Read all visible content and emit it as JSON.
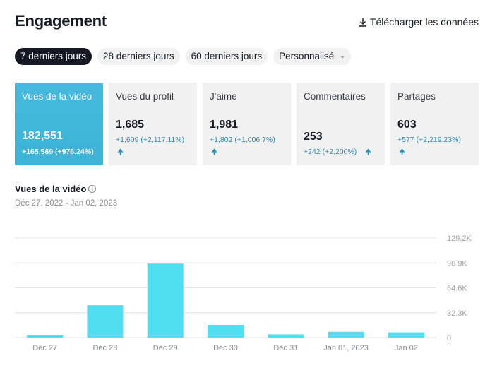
{
  "header": {
    "title": "Engagement",
    "download_label": "Télécharger les données"
  },
  "tabs": [
    {
      "label": "7 derniers jours",
      "active": true
    },
    {
      "label": "28 derniers jours",
      "active": false
    },
    {
      "label": "60 derniers jours",
      "active": false
    },
    {
      "label": "Personnalisé",
      "active": false
    }
  ],
  "cards": [
    {
      "label": "Vues de la vidéo",
      "value": "182,551",
      "delta": "+165,589 (+976.24%)",
      "active": true
    },
    {
      "label": "Vues du profil",
      "value": "1,685",
      "delta": "+1,609 (+2,117.11%)",
      "active": false
    },
    {
      "label": "J'aime",
      "value": "1,981",
      "delta": "+1,802 (+1,006.7%)",
      "active": false
    },
    {
      "label": "Commentaires",
      "value": "253",
      "delta": "+242 (+2,200%)",
      "active": false
    },
    {
      "label": "Partages",
      "value": "603",
      "delta": "+577 (+2,219.23%)",
      "active": false
    }
  ],
  "chart_section": {
    "title": "Vues de la vidéo",
    "date_range": "Déc 27, 2022 - Jan 02, 2023"
  },
  "colors": {
    "accent": "#47b9de",
    "bar": "#4fdff0",
    "delta_text": "#2a8bb0"
  },
  "chart_data": {
    "type": "bar",
    "categories": [
      "Déc 27",
      "Déc 28",
      "Déc 29",
      "Déc 30",
      "Déc 31",
      "Jan 01, 2023",
      "Jan 02"
    ],
    "values": [
      3200,
      42000,
      96000,
      16500,
      4200,
      7500,
      6800
    ],
    "y_ticks": [
      "0",
      "32.3K",
      "64.6K",
      "96.9K",
      "129.2K"
    ],
    "ylim": [
      0,
      129200
    ],
    "grid": true
  }
}
